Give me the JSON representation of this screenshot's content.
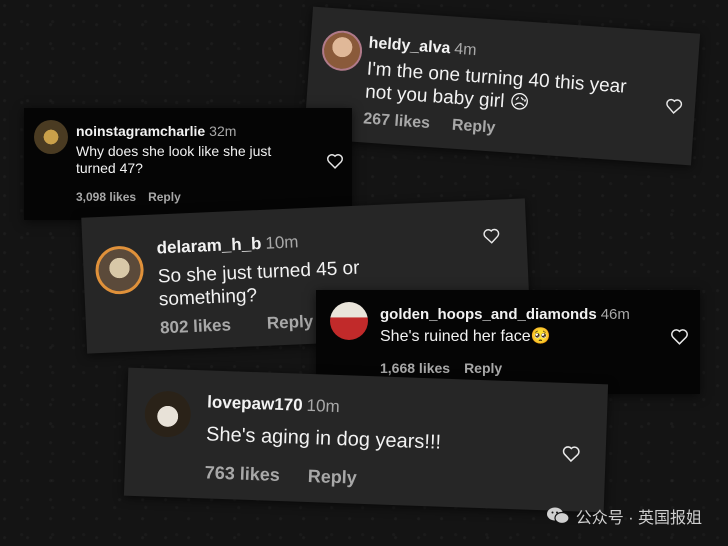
{
  "comments": [
    {
      "username": "heldy_alva",
      "time": "4m",
      "text": "I'm the one turning 40 this year not you baby girl 😥",
      "likes": "267 likes",
      "reply": "Reply"
    },
    {
      "username": "noinstagramcharlie",
      "time": "32m",
      "text": "Why does she look like she just turned 47?",
      "likes": "3,098 likes",
      "reply": "Reply"
    },
    {
      "username": "delaram_h_b",
      "time": "10m",
      "text": "So she just turned 45 or something?",
      "likes": "802 likes",
      "reply": "Reply"
    },
    {
      "username": "golden_hoops_and_diamonds",
      "time": "46m",
      "text": "She's ruined her face🥺",
      "likes": "1,668 likes",
      "reply": "Reply"
    },
    {
      "username": "lovepaw170",
      "time": "10m",
      "text": "She's aging in dog years!!!",
      "likes": "763 likes",
      "reply": "Reply"
    }
  ],
  "watermark": {
    "icon": "wechat-icon",
    "text": "公众号 · 英国报姐"
  },
  "colors": {
    "card": "#262626",
    "card_dark": "#050505",
    "muted": "#a8a8a8"
  }
}
